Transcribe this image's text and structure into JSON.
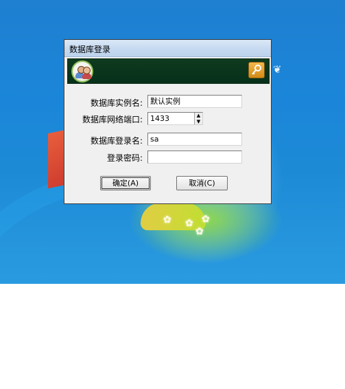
{
  "window": {
    "title": "数据库登录"
  },
  "form": {
    "instance": {
      "label": "数据库实例名:",
      "value": "默认实例"
    },
    "port": {
      "label": "数据库网络端口:",
      "value": "1433"
    },
    "login": {
      "label": "数据库登录名:",
      "value": "sa"
    },
    "password": {
      "label": "登录密码:",
      "value": ""
    }
  },
  "buttons": {
    "ok": "确定(A)",
    "cancel": "取消(C)"
  },
  "icons": {
    "logo": "users-avatar-icon",
    "key": "key-icon",
    "spin_up": "spin-up-arrow-icon",
    "spin_down": "spin-down-arrow-icon"
  },
  "colors": {
    "banner": "#06301a",
    "key_button": "#e0a030",
    "titlebar": "#c7daf0"
  }
}
